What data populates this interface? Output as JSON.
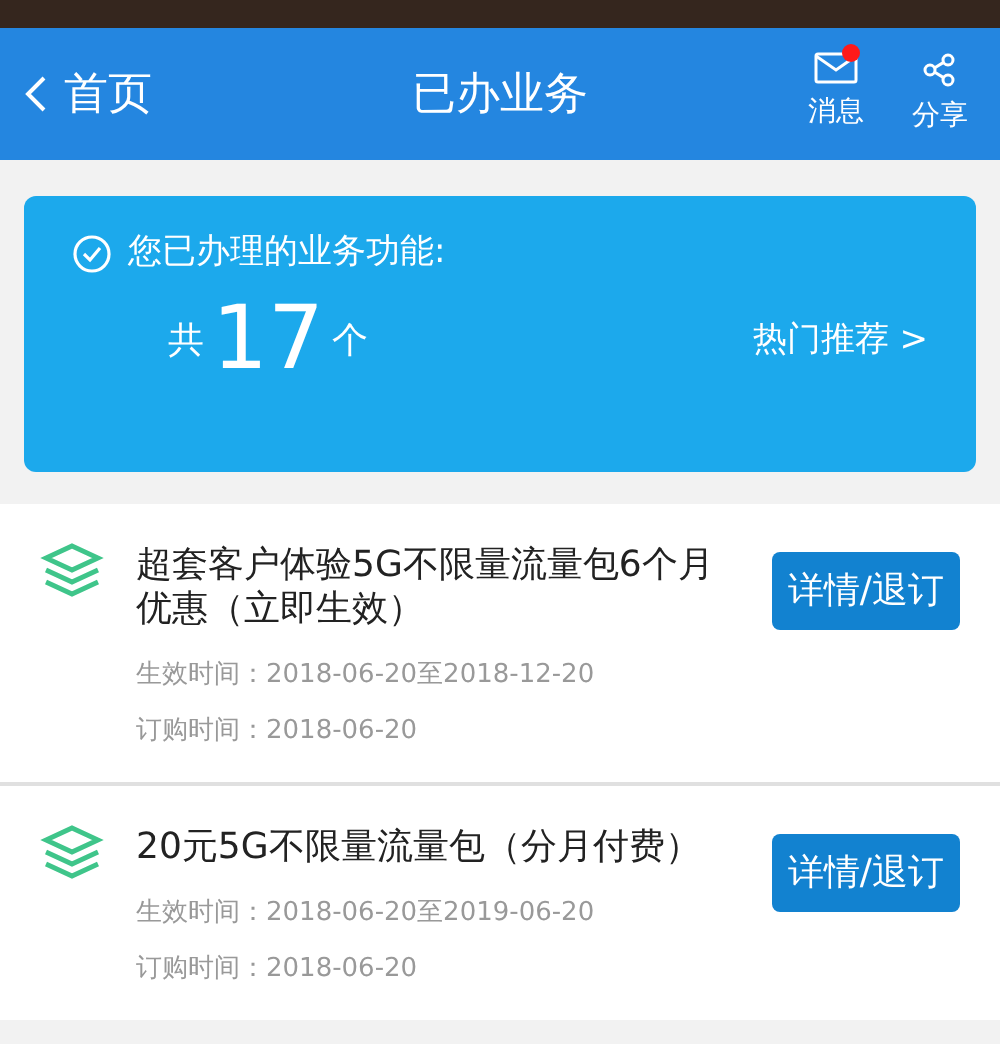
{
  "header": {
    "back_label": "首页",
    "title": "已办业务",
    "actions": [
      {
        "kind": "message",
        "label": "消息",
        "badge": true
      },
      {
        "kind": "share",
        "label": "分享",
        "badge": false
      }
    ]
  },
  "summary": {
    "label": "您已办理的业务功能:",
    "prefix": "共",
    "count": "17",
    "suffix": "个",
    "link": "热门推荐 >"
  },
  "services": [
    {
      "name": "超套客户体验5G不限量流量包6个月优惠（立即生效）",
      "effective": "生效时间：2018-06-20至2018-12-20",
      "ordered": "订购时间：2018-06-20",
      "button": "详情/退订"
    },
    {
      "name": "20元5G不限量流量包（分月付费）",
      "effective": "生效时间：2018-06-20至2019-06-20",
      "ordered": "订购时间：2018-06-20",
      "button": "详情/退订"
    }
  ]
}
